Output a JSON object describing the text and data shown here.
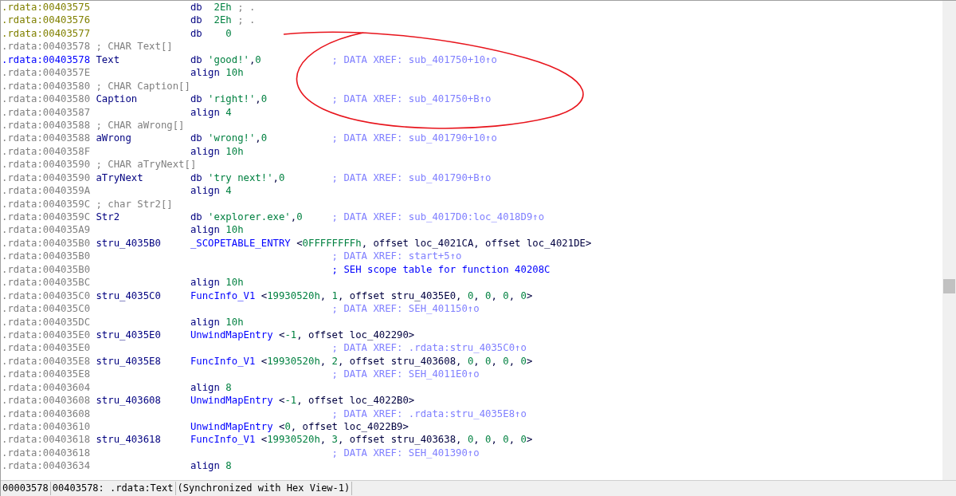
{
  "lines": [
    {
      "addr": ".rdata:00403575",
      "kind": "bytes",
      "selected": false,
      "code": [
        {
          "text": "db",
          "kind": "mnemonic"
        },
        {
          "text": "  2Eh",
          "kind": "number"
        },
        {
          "text": " ; .",
          "kind": "remark"
        }
      ]
    },
    {
      "addr": ".rdata:00403576",
      "kind": "bytes",
      "selected": false,
      "code": [
        {
          "text": "db",
          "kind": "mnemonic"
        },
        {
          "text": "  2Eh",
          "kind": "number"
        },
        {
          "text": " ; .",
          "kind": "remark"
        }
      ]
    },
    {
      "addr": ".rdata:00403577",
      "kind": "bytes",
      "selected": false,
      "code": [
        {
          "text": "db",
          "kind": "mnemonic"
        },
        {
          "text": "    0",
          "kind": "number"
        }
      ]
    },
    {
      "addr": ".rdata:00403578",
      "kind": "item",
      "selected": false,
      "label": {
        "text": "; CHAR Text[]",
        "kind": "remark"
      }
    },
    {
      "addr": ".rdata:00403578",
      "kind": "item",
      "selected": true,
      "label": {
        "text": "Text",
        "kind": "name"
      },
      "code": [
        {
          "text": "db",
          "kind": "mnemonic"
        },
        {
          "text": " 'good!'",
          "kind": "string"
        },
        {
          "text": ",",
          "kind": "operand"
        },
        {
          "text": "0",
          "kind": "number"
        }
      ],
      "comment": {
        "text": "; DATA XREF: sub_401750+10↑o",
        "kind": "xref"
      }
    },
    {
      "addr": ".rdata:0040357E",
      "kind": "item",
      "selected": false,
      "code": [
        {
          "text": "align",
          "kind": "mnemonic"
        },
        {
          "text": " 10h",
          "kind": "number"
        }
      ]
    },
    {
      "addr": ".rdata:00403580",
      "kind": "item",
      "selected": false,
      "label": {
        "text": "; CHAR Caption[]",
        "kind": "remark"
      }
    },
    {
      "addr": ".rdata:00403580",
      "kind": "item",
      "selected": false,
      "label": {
        "text": "Caption",
        "kind": "name"
      },
      "code": [
        {
          "text": "db",
          "kind": "mnemonic"
        },
        {
          "text": " 'right!'",
          "kind": "string"
        },
        {
          "text": ",",
          "kind": "operand"
        },
        {
          "text": "0",
          "kind": "number"
        }
      ],
      "comment": {
        "text": "; DATA XREF: sub_401750+B↑o",
        "kind": "xref"
      }
    },
    {
      "addr": ".rdata:00403587",
      "kind": "item",
      "selected": false,
      "code": [
        {
          "text": "align",
          "kind": "mnemonic"
        },
        {
          "text": " 4",
          "kind": "number"
        }
      ]
    },
    {
      "addr": ".rdata:00403588",
      "kind": "item",
      "selected": false,
      "label": {
        "text": "; CHAR aWrong[]",
        "kind": "remark"
      }
    },
    {
      "addr": ".rdata:00403588",
      "kind": "item",
      "selected": false,
      "label": {
        "text": "aWrong",
        "kind": "name"
      },
      "code": [
        {
          "text": "db",
          "kind": "mnemonic"
        },
        {
          "text": " 'wrong!'",
          "kind": "string"
        },
        {
          "text": ",",
          "kind": "operand"
        },
        {
          "text": "0",
          "kind": "number"
        }
      ],
      "comment": {
        "text": "; DATA XREF: sub_401790+10↑o",
        "kind": "xref"
      }
    },
    {
      "addr": ".rdata:0040358F",
      "kind": "item",
      "selected": false,
      "code": [
        {
          "text": "align",
          "kind": "mnemonic"
        },
        {
          "text": " 10h",
          "kind": "number"
        }
      ]
    },
    {
      "addr": ".rdata:00403590",
      "kind": "item",
      "selected": false,
      "label": {
        "text": "; CHAR aTryNext[]",
        "kind": "remark"
      }
    },
    {
      "addr": ".rdata:00403590",
      "kind": "item",
      "selected": false,
      "label": {
        "text": "aTryNext",
        "kind": "name"
      },
      "code": [
        {
          "text": "db",
          "kind": "mnemonic"
        },
        {
          "text": " 'try next!'",
          "kind": "string"
        },
        {
          "text": ",",
          "kind": "operand"
        },
        {
          "text": "0",
          "kind": "number"
        }
      ],
      "comment": {
        "text": "; DATA XREF: sub_401790+B↑o",
        "kind": "xref"
      }
    },
    {
      "addr": ".rdata:0040359A",
      "kind": "item",
      "selected": false,
      "code": [
        {
          "text": "align",
          "kind": "mnemonic"
        },
        {
          "text": " 4",
          "kind": "number"
        }
      ]
    },
    {
      "addr": ".rdata:0040359C",
      "kind": "item",
      "selected": false,
      "label": {
        "text": "; char Str2[]",
        "kind": "remark"
      }
    },
    {
      "addr": ".rdata:0040359C",
      "kind": "item",
      "selected": false,
      "label": {
        "text": "Str2",
        "kind": "name"
      },
      "code": [
        {
          "text": "db",
          "kind": "mnemonic"
        },
        {
          "text": " 'explorer.exe'",
          "kind": "string"
        },
        {
          "text": ",",
          "kind": "operand"
        },
        {
          "text": "0",
          "kind": "number"
        }
      ],
      "comment": {
        "text": "; DATA XREF: sub_4017D0:loc_4018D9↑o",
        "kind": "xref"
      }
    },
    {
      "addr": ".rdata:004035A9",
      "kind": "item",
      "selected": false,
      "code": [
        {
          "text": "align",
          "kind": "mnemonic"
        },
        {
          "text": " 10h",
          "kind": "number"
        }
      ]
    },
    {
      "addr": ".rdata:004035B0",
      "kind": "item",
      "selected": false,
      "label": {
        "text": "stru_4035B0",
        "kind": "name"
      },
      "code": [
        {
          "text": "_SCOPETABLE_ENTRY",
          "kind": "struct"
        },
        {
          "text": " <",
          "kind": "operand"
        },
        {
          "text": "0FFFFFFFFh",
          "kind": "number"
        },
        {
          "text": ", offset loc_4021CA, offset loc_4021DE>",
          "kind": "operand"
        }
      ]
    },
    {
      "addr": ".rdata:004035B0",
      "kind": "item",
      "selected": false,
      "comment": {
        "text": "; DATA XREF: start+5↑o",
        "kind": "xref"
      }
    },
    {
      "addr": ".rdata:004035B0",
      "kind": "item",
      "selected": false,
      "comment": {
        "text": "; SEH scope table for function 40208C",
        "kind": "note"
      }
    },
    {
      "addr": ".rdata:004035BC",
      "kind": "item",
      "selected": false,
      "code": [
        {
          "text": "align",
          "kind": "mnemonic"
        },
        {
          "text": " 10h",
          "kind": "number"
        }
      ]
    },
    {
      "addr": ".rdata:004035C0",
      "kind": "item",
      "selected": false,
      "label": {
        "text": "stru_4035C0",
        "kind": "name"
      },
      "code": [
        {
          "text": "FuncInfo_V1",
          "kind": "struct"
        },
        {
          "text": " <",
          "kind": "operand"
        },
        {
          "text": "19930520h",
          "kind": "number"
        },
        {
          "text": ", ",
          "kind": "operand"
        },
        {
          "text": "1",
          "kind": "number"
        },
        {
          "text": ", offset stru_4035E0, ",
          "kind": "operand"
        },
        {
          "text": "0",
          "kind": "number"
        },
        {
          "text": ", ",
          "kind": "operand"
        },
        {
          "text": "0",
          "kind": "number"
        },
        {
          "text": ", ",
          "kind": "operand"
        },
        {
          "text": "0",
          "kind": "number"
        },
        {
          "text": ", ",
          "kind": "operand"
        },
        {
          "text": "0",
          "kind": "number"
        },
        {
          "text": ">",
          "kind": "operand"
        }
      ]
    },
    {
      "addr": ".rdata:004035C0",
      "kind": "item",
      "selected": false,
      "comment": {
        "text": "; DATA XREF: SEH_401150↑o",
        "kind": "xref"
      }
    },
    {
      "addr": ".rdata:004035DC",
      "kind": "item",
      "selected": false,
      "code": [
        {
          "text": "align",
          "kind": "mnemonic"
        },
        {
          "text": " 10h",
          "kind": "number"
        }
      ]
    },
    {
      "addr": ".rdata:004035E0",
      "kind": "item",
      "selected": false,
      "label": {
        "text": "stru_4035E0",
        "kind": "name"
      },
      "code": [
        {
          "text": "UnwindMapEntry",
          "kind": "struct"
        },
        {
          "text": " <",
          "kind": "operand"
        },
        {
          "text": "-1",
          "kind": "number"
        },
        {
          "text": ", offset loc_402290>",
          "kind": "operand"
        }
      ]
    },
    {
      "addr": ".rdata:004035E0",
      "kind": "item",
      "selected": false,
      "comment": {
        "text": "; DATA XREF: .rdata:stru_4035C0↑o",
        "kind": "xref"
      }
    },
    {
      "addr": ".rdata:004035E8",
      "kind": "item",
      "selected": false,
      "label": {
        "text": "stru_4035E8",
        "kind": "name"
      },
      "code": [
        {
          "text": "FuncInfo_V1",
          "kind": "struct"
        },
        {
          "text": " <",
          "kind": "operand"
        },
        {
          "text": "19930520h",
          "kind": "number"
        },
        {
          "text": ", ",
          "kind": "operand"
        },
        {
          "text": "2",
          "kind": "number"
        },
        {
          "text": ", offset stru_403608, ",
          "kind": "operand"
        },
        {
          "text": "0",
          "kind": "number"
        },
        {
          "text": ", ",
          "kind": "operand"
        },
        {
          "text": "0",
          "kind": "number"
        },
        {
          "text": ", ",
          "kind": "operand"
        },
        {
          "text": "0",
          "kind": "number"
        },
        {
          "text": ", ",
          "kind": "operand"
        },
        {
          "text": "0",
          "kind": "number"
        },
        {
          "text": ">",
          "kind": "operand"
        }
      ]
    },
    {
      "addr": ".rdata:004035E8",
      "kind": "item",
      "selected": false,
      "comment": {
        "text": "; DATA XREF: SEH_4011E0↑o",
        "kind": "xref"
      }
    },
    {
      "addr": ".rdata:00403604",
      "kind": "item",
      "selected": false,
      "code": [
        {
          "text": "align",
          "kind": "mnemonic"
        },
        {
          "text": " 8",
          "kind": "number"
        }
      ]
    },
    {
      "addr": ".rdata:00403608",
      "kind": "item",
      "selected": false,
      "label": {
        "text": "stru_403608",
        "kind": "name"
      },
      "code": [
        {
          "text": "UnwindMapEntry",
          "kind": "struct"
        },
        {
          "text": " <",
          "kind": "operand"
        },
        {
          "text": "-1",
          "kind": "number"
        },
        {
          "text": ", offset loc_4022B0>",
          "kind": "operand"
        }
      ]
    },
    {
      "addr": ".rdata:00403608",
      "kind": "item",
      "selected": false,
      "comment": {
        "text": "; DATA XREF: .rdata:stru_4035E8↑o",
        "kind": "xref"
      }
    },
    {
      "addr": ".rdata:00403610",
      "kind": "item",
      "selected": false,
      "code": [
        {
          "text": "UnwindMapEntry",
          "kind": "struct"
        },
        {
          "text": " <",
          "kind": "operand"
        },
        {
          "text": "0",
          "kind": "number"
        },
        {
          "text": ", offset loc_4022B9>",
          "kind": "operand"
        }
      ]
    },
    {
      "addr": ".rdata:00403618",
      "kind": "item",
      "selected": false,
      "label": {
        "text": "stru_403618",
        "kind": "name"
      },
      "code": [
        {
          "text": "FuncInfo_V1",
          "kind": "struct"
        },
        {
          "text": " <",
          "kind": "operand"
        },
        {
          "text": "19930520h",
          "kind": "number"
        },
        {
          "text": ", ",
          "kind": "operand"
        },
        {
          "text": "3",
          "kind": "number"
        },
        {
          "text": ", offset stru_403638, ",
          "kind": "operand"
        },
        {
          "text": "0",
          "kind": "number"
        },
        {
          "text": ", ",
          "kind": "operand"
        },
        {
          "text": "0",
          "kind": "number"
        },
        {
          "text": ", ",
          "kind": "operand"
        },
        {
          "text": "0",
          "kind": "number"
        },
        {
          "text": ", ",
          "kind": "operand"
        },
        {
          "text": "0",
          "kind": "number"
        },
        {
          "text": ">",
          "kind": "operand"
        }
      ]
    },
    {
      "addr": ".rdata:00403618",
      "kind": "item",
      "selected": false,
      "comment": {
        "text": "; DATA XREF: SEH_401390↑o",
        "kind": "xref"
      }
    },
    {
      "addr": ".rdata:00403634",
      "kind": "item",
      "selected": false,
      "code": [
        {
          "text": "align",
          "kind": "mnemonic"
        },
        {
          "text": " 8",
          "kind": "number"
        }
      ]
    }
  ],
  "status_bar": [
    "00003578",
    "00403578: .rdata:Text",
    "(Synchronized with Hex View-1)"
  ]
}
